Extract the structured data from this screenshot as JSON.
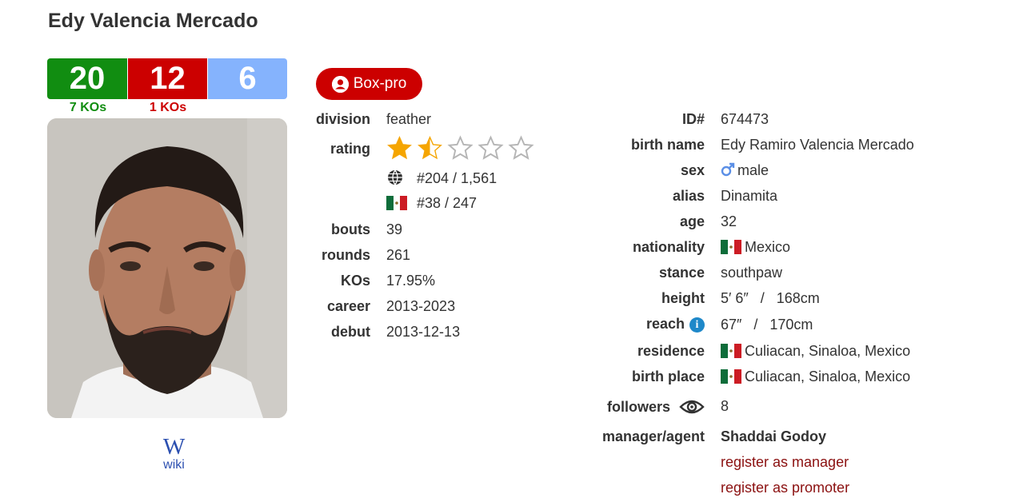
{
  "boxer": {
    "name": "Edy Valencia Mercado"
  },
  "record": {
    "wins": "20",
    "losses": "12",
    "draws": "6",
    "win_kos": "7 KOs",
    "loss_kos": "1 KOs",
    "colors": {
      "win": "#118d11",
      "loss": "#cc0000",
      "draw": "#85b3fd"
    }
  },
  "wiki": {
    "logo": "W",
    "label": "wiki"
  },
  "badge": {
    "label": "Box-pro",
    "icon": "user-circle-icon",
    "color": "#cc0000"
  },
  "left": {
    "division_label": "division",
    "division": "feather",
    "rating_label": "rating",
    "rating_stars": 1.5,
    "rating_max": 5,
    "world_rank": "#204 / 1,561",
    "world_icon": "globe-icon",
    "country_rank": "#38 / 247",
    "country_icon": "mexico-flag-icon",
    "bouts_label": "bouts",
    "bouts": "39",
    "rounds_label": "rounds",
    "rounds": "261",
    "kos_label": "KOs",
    "kos": "17.95%",
    "career_label": "career",
    "career": "2013-2023",
    "debut_label": "debut",
    "debut": "2013-12-13"
  },
  "right": {
    "id_label": "ID#",
    "id": "674473",
    "birth_name_label": "birth name",
    "birth_name": "Edy Ramiro Valencia Mercado",
    "sex_label": "sex",
    "sex": "male",
    "sex_icon": "male-symbol-icon",
    "alias_label": "alias",
    "alias": "Dinamita",
    "age_label": "age",
    "age": "32",
    "nationality_label": "nationality",
    "nationality": "Mexico",
    "stance_label": "stance",
    "stance": "southpaw",
    "height_label": "height",
    "height": "5′ 6″   /   168cm",
    "reach_label": "reach",
    "reach": "67″   /   170cm",
    "residence_label": "residence",
    "residence": "Culiacan, Sinaloa, Mexico",
    "birth_place_label": "birth place",
    "birth_place": "Culiacan, Sinaloa, Mexico",
    "followers_label": "followers",
    "followers": "8",
    "followers_icon": "eye-icon",
    "manager_label": "manager/agent",
    "manager": "Shaddai Godoy",
    "register_manager": "register as manager",
    "register_promoter": "register as promoter"
  }
}
